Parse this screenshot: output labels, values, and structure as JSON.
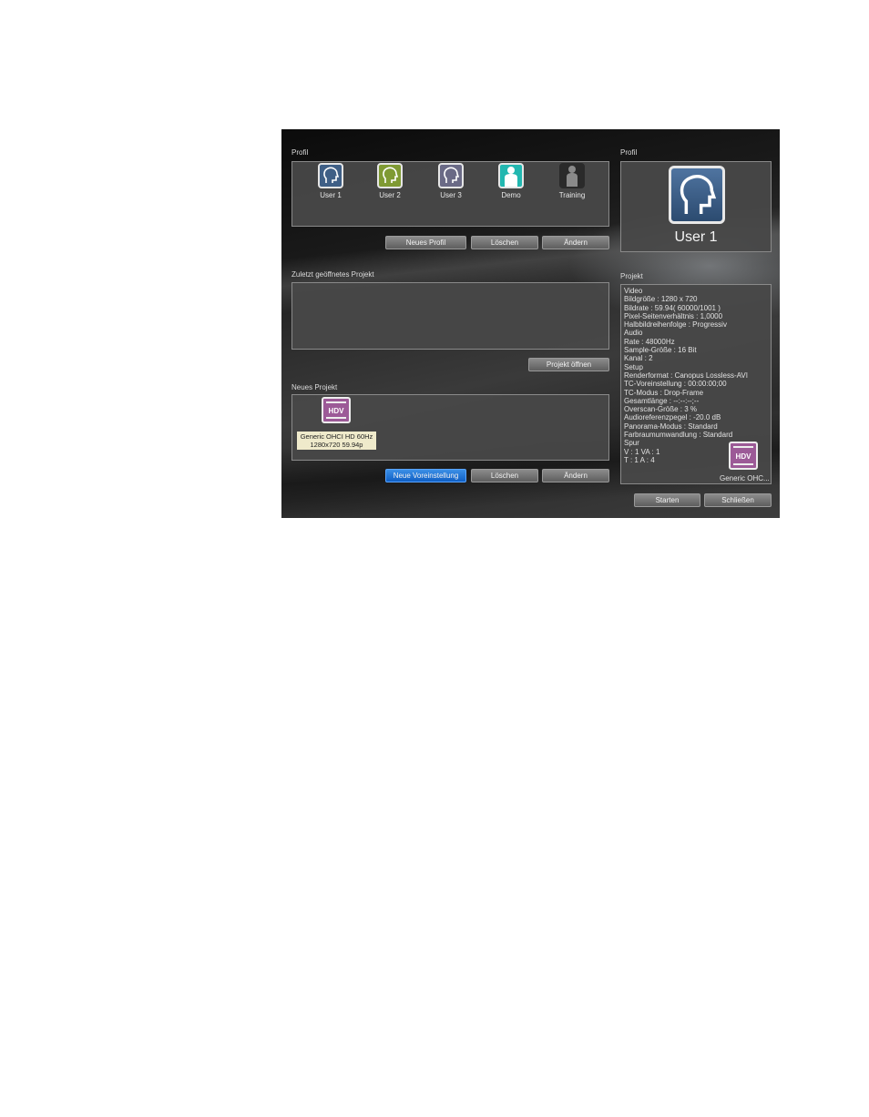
{
  "profile": {
    "title": "Profil",
    "users": [
      {
        "name": "User 1",
        "color": "#3f5f86"
      },
      {
        "name": "User 2",
        "color": "#7f9a33"
      },
      {
        "name": "User 3",
        "color": "#6a6a86"
      },
      {
        "name": "Demo",
        "color": "#22b7b0"
      },
      {
        "name": "Training",
        "color": "#2a2a2a"
      }
    ],
    "buttons": {
      "new": "Neues Profil",
      "delete": "Löschen",
      "change": "Ändern"
    }
  },
  "selected_profile": {
    "title": "Profil",
    "name": "User 1"
  },
  "recent": {
    "title": "Zuletzt geöffnetes Projekt",
    "open_button": "Projekt öffnen"
  },
  "new_project": {
    "title": "Neues Projekt",
    "preset_badge": "HDV",
    "preset_line1": "Generic OHCI HD 60Hz",
    "preset_line2": "1280x720 59.94p",
    "buttons": {
      "new": "Neue Voreinstellung",
      "delete": "Löschen",
      "change": "Ändern"
    }
  },
  "project": {
    "title": "Projekt",
    "lines": [
      "Video",
      "Bildgröße : 1280 x 720",
      "Bildrate : 59.94( 60000/1001 )",
      "Pixel-Seitenverhältnis : 1,0000",
      "Halbbildreihenfolge : Progressiv",
      "Audio",
      "Rate : 48000Hz",
      "Sample-Größe : 16 Bit",
      "Kanal : 2",
      "Setup",
      "Renderformat : Canopus Lossless-AVI",
      "TC-Voreinstellung : 00:00:00;00",
      "TC-Modus : Drop-Frame",
      "Gesamtlänge : --:--:--;--",
      "Overscan-Größe : 3 %",
      "Audioreferenzpegel : -20.0 dB",
      "Panorama-Modus : Standard",
      "Farbraumumwandlung : Standard",
      "Spur",
      "V : 1  VA : 1",
      "T : 1  A : 4"
    ],
    "preset_badge": "HDV",
    "preset_label": "Generic OHC..."
  },
  "footer": {
    "start": "Starten",
    "close": "Schließen"
  }
}
